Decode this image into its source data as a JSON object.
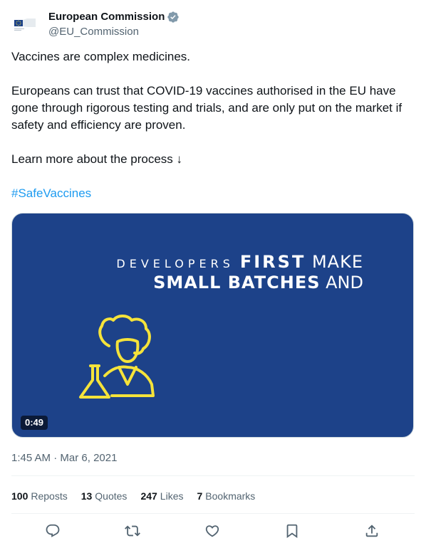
{
  "author": {
    "display_name": "European Commission",
    "handle": "@EU_Commission",
    "verified_icon": "verified-badge-icon",
    "avatar_icon": "eu-flag-logo"
  },
  "tweet": {
    "paragraph1": "Vaccines are complex medicines.",
    "paragraph2": "Europeans can trust that COVID-19 vaccines authorised in the EU have gone through rigorous testing and trials, and are only put on the market if safety and efficiency are proven.",
    "paragraph3": "Learn more about the process ↓",
    "hashtag": "#SafeVaccines"
  },
  "media": {
    "line1_spaced": "DEVELOPERS",
    "line1_bold": "FIRST",
    "line1_rest": "MAKE",
    "line2_bold": "SMALL BATCHES",
    "line2_rest": "AND",
    "duration": "0:49",
    "background_color": "#1d4289",
    "illustration_color": "#f5e33a"
  },
  "timestamp": {
    "time": "1:45 AM",
    "separator": " · ",
    "date": "Mar 6, 2021"
  },
  "stats": {
    "reposts_num": "100",
    "reposts_label": "Reposts",
    "quotes_num": "13",
    "quotes_label": "Quotes",
    "likes_num": "247",
    "likes_label": "Likes",
    "bookmarks_num": "7",
    "bookmarks_label": "Bookmarks"
  },
  "actions": [
    "reply-icon",
    "repost-icon",
    "like-icon",
    "bookmark-icon",
    "share-icon"
  ],
  "colors": {
    "text": "#0f1419",
    "secondary": "#536471",
    "link": "#1d9bf0",
    "verified": "#829aab"
  }
}
